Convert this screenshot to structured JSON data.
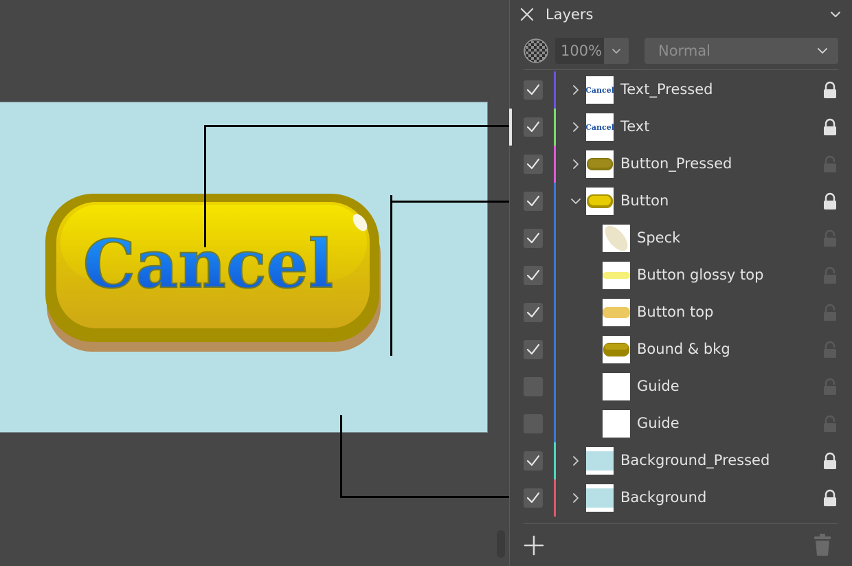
{
  "panel": {
    "title": "Layers",
    "opacity": "100%",
    "blend_mode": "Normal"
  },
  "layers": [
    {
      "name": "Text_Pressed",
      "checked": true,
      "color": "#6b55e0",
      "expander": "collapsed",
      "indent": 0,
      "thumb": "text",
      "thumb_text": "Cancel",
      "locked": true
    },
    {
      "name": "Text",
      "checked": true,
      "color": "#7ddc6a",
      "expander": "collapsed",
      "indent": 0,
      "thumb": "text",
      "thumb_text": "Cancel",
      "locked": true
    },
    {
      "name": "Button_Pressed",
      "checked": true,
      "color": "#e05ad8",
      "expander": "collapsed",
      "indent": 0,
      "thumb": "pill-dark",
      "locked": false
    },
    {
      "name": "Button",
      "checked": true,
      "color": "#3d78d8",
      "expander": "expanded",
      "indent": 0,
      "thumb": "pill-gold",
      "locked": true
    },
    {
      "name": "Speck",
      "checked": true,
      "color": "#3d78d8",
      "expander": "none",
      "indent": 1,
      "thumb": "speck",
      "locked": false
    },
    {
      "name": "Button glossy top",
      "checked": true,
      "color": "#3d78d8",
      "expander": "none",
      "indent": 1,
      "thumb": "glossy",
      "locked": false
    },
    {
      "name": "Button top",
      "checked": true,
      "color": "#3d78d8",
      "expander": "none",
      "indent": 1,
      "thumb": "top",
      "locked": false
    },
    {
      "name": "Bound & bkg",
      "checked": true,
      "color": "#3d78d8",
      "expander": "none",
      "indent": 1,
      "thumb": "pill-olive",
      "locked": false
    },
    {
      "name": "Guide",
      "checked": false,
      "color": "#3d78d8",
      "expander": "none",
      "indent": 1,
      "thumb": "blank",
      "locked": false
    },
    {
      "name": "Guide",
      "checked": false,
      "color": "#3d78d8",
      "expander": "none",
      "indent": 1,
      "thumb": "blank",
      "locked": false
    },
    {
      "name": "Background_Pressed",
      "checked": true,
      "color": "#4fd8c0",
      "expander": "collapsed",
      "indent": 0,
      "thumb": "bg",
      "locked": true
    },
    {
      "name": "Background",
      "checked": true,
      "color": "#e05a6a",
      "expander": "collapsed",
      "indent": 0,
      "thumb": "bg",
      "locked": true
    }
  ],
  "artwork": {
    "button_label": "Cancel"
  },
  "colors": {
    "artboard": "#b7e0e6",
    "panel_bg": "#444444",
    "canvas_bg": "#474747",
    "button_gold": "#e2c200",
    "label_blue": "#1a78f0"
  }
}
